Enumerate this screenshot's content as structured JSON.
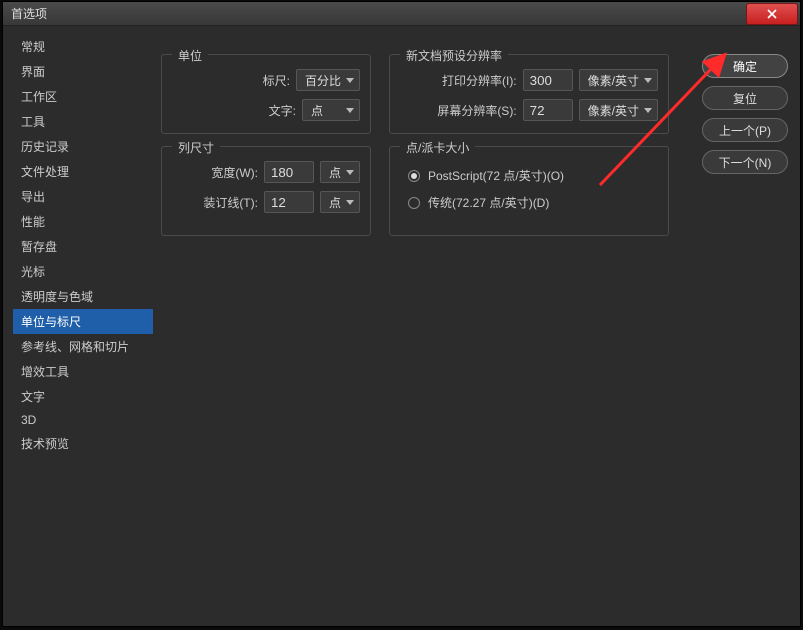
{
  "window": {
    "title": "首选项"
  },
  "sidebar": {
    "items": [
      "常规",
      "界面",
      "工作区",
      "工具",
      "历史记录",
      "文件处理",
      "导出",
      "性能",
      "暂存盘",
      "光标",
      "透明度与色域",
      "单位与标尺",
      "参考线、网格和切片",
      "增效工具",
      "文字",
      "3D",
      "技术预览"
    ],
    "selectedIndex": 11
  },
  "groups": {
    "units": {
      "title": "单位",
      "rulerLabel": "标尺:",
      "rulerValue": "百分比",
      "typeLabel": "文字:",
      "typeValue": "点"
    },
    "colsize": {
      "title": "列尺寸",
      "widthLabel": "宽度(W):",
      "widthValue": "180",
      "widthUnit": "点",
      "gutterLabel": "装订线(T):",
      "gutterValue": "12",
      "gutterUnit": "点"
    },
    "newdoc": {
      "title": "新文档预设分辨率",
      "printLabel": "打印分辨率(I):",
      "printValue": "300",
      "printUnit": "像素/英寸",
      "screenLabel": "屏幕分辨率(S):",
      "screenValue": "72",
      "screenUnit": "像素/英寸"
    },
    "pica": {
      "title": "点/派卡大小",
      "postscript": "PostScript(72 点/英寸)(O)",
      "traditional": "传统(72.27 点/英寸)(D)"
    }
  },
  "buttons": {
    "ok": "确定",
    "reset": "复位",
    "prev": "上一个(P)",
    "next": "下一个(N)"
  }
}
